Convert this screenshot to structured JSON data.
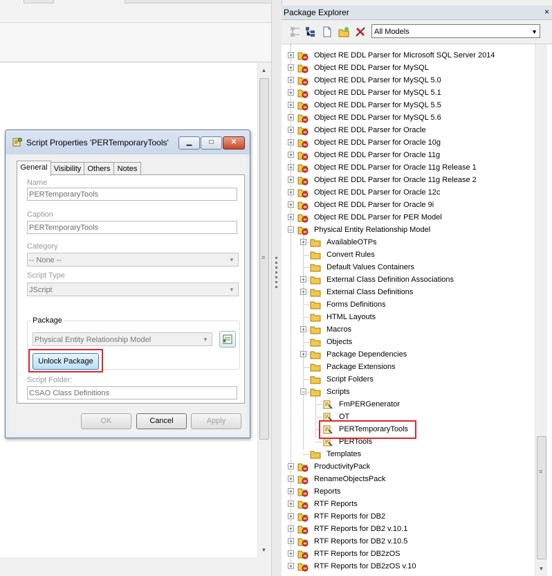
{
  "dialog": {
    "title": "Script Properties  'PERTemporaryTools'",
    "tabs": [
      "General",
      "Visibility",
      "Others",
      "Notes"
    ],
    "fields": {
      "name_label": "Name",
      "name_value": "PERTemporaryTools",
      "caption_label": "Caption",
      "caption_value": "PERTemporaryTools",
      "category_label": "Category",
      "category_value": "-- None --",
      "script_type_label": "Script Type",
      "script_type_value": "JScript",
      "package_label": "Package",
      "package_value": "Physical Entity Relationship Model",
      "unlock_label": "Unlock Package",
      "script_folder_label": "Script Folder:",
      "script_folder_value": "CSAO Class Definitions"
    },
    "buttons": {
      "ok": "OK",
      "cancel": "Cancel",
      "apply": "Apply"
    }
  },
  "explorer": {
    "title": "Package Explorer",
    "close": "×",
    "models_filter": "All Models",
    "tree": [
      "Object RE DDL Parser for Microsoft SQL Server 2014",
      "Object RE DDL Parser for MySQL",
      "Object RE DDL Parser for MySQL 5.0",
      "Object RE DDL Parser for MySQL 5.1",
      "Object RE DDL Parser for MySQL 5.5",
      "Object RE DDL Parser for MySQL 5.6",
      "Object RE DDL Parser for Oracle",
      "Object RE DDL Parser for Oracle 10g",
      "Object RE DDL Parser for Oracle 11g",
      "Object RE DDL Parser for Oracle 11g Release 1",
      "Object RE DDL Parser for Oracle 11g Release 2",
      "Object RE DDL Parser for Oracle 12c",
      "Object RE DDL Parser for Oracle 9i",
      "Object RE DDL Parser for PER Model",
      "Physical Entity Relationship Model",
      "AvailableOTPs",
      "Convert Rules",
      "Default Values Containers",
      "External Class Definition Associations",
      "External Class Definitions",
      "Forms Definitions",
      "HTML Layouts",
      "Macros",
      "Objects",
      "Package Dependencies",
      "Package Extensions",
      "Script Folders",
      "Scripts",
      "FmPERGenerator",
      "OT",
      "PERTemporaryTools",
      "PERTools",
      "Templates",
      "ProductivityPack",
      "RenameObjectsPack",
      "Reports",
      "RTF Reports",
      "RTF Reports for DB2",
      "RTF Reports for DB2 v.10.1",
      "RTF Reports for DB2 v.10.5",
      "RTF Reports for DB2zOS",
      "RTF Reports for DB2zOS v.10"
    ]
  },
  "colors": {
    "highlight_red": "#e0242c",
    "folder_yellow": "#f2c94c",
    "accent_blue": "#3c7fb1"
  }
}
